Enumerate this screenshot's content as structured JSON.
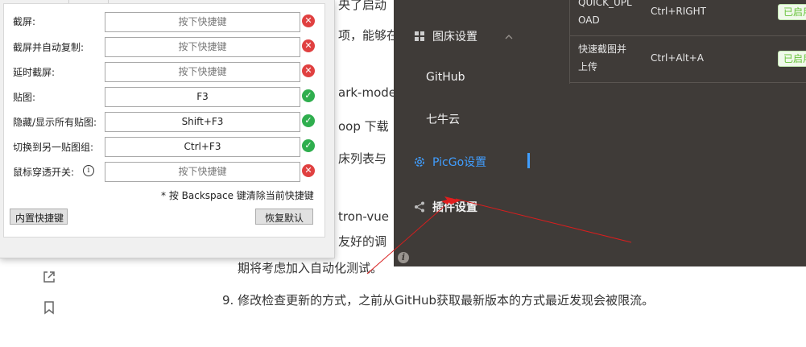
{
  "article": {
    "fragments": [
      "央了启动",
      "项，能够在",
      "ark-mode",
      "oop 下载",
      "床列表与",
      "tron-vue",
      "友好的调"
    ],
    "line_8_cont": "期将考虑加入自动化测试。",
    "line_9": "9. 修改检查更新的方式，之前从GitHub获取最新版本的方式最近发现会被限流。",
    "icons": [
      "external-link-icon",
      "bookmark-icon"
    ]
  },
  "picgo": {
    "nav": [
      {
        "label": "图床设置",
        "icon": "grid-icon"
      },
      {
        "label": "GitHub"
      },
      {
        "label": "七牛云"
      },
      {
        "label": "PicGo设置",
        "icon": "gear-icon",
        "active": true
      },
      {
        "label": "插件设置",
        "icon": "share-icon"
      }
    ],
    "table": [
      {
        "name": "QUICK_UPL OAD",
        "name_l1": "QUICK_UPL",
        "name_l2": "OAD",
        "key": "Ctrl+RIGHT",
        "status": "已启用"
      },
      {
        "name": "快速截图并上传",
        "name_l1": "快速截图并",
        "name_l2": "上传",
        "key": "Ctrl+Alt+A",
        "status": "已启用"
      }
    ],
    "accent": "#409eff"
  },
  "shortcuts": {
    "rows": [
      {
        "label": "截屏:",
        "value": "",
        "placeholder": "按下快捷键",
        "status": "error"
      },
      {
        "label": "截屏并自动复制:",
        "value": "",
        "placeholder": "按下快捷键",
        "status": "error"
      },
      {
        "label": "延时截屏:",
        "value": "",
        "placeholder": "按下快捷键",
        "status": "error"
      },
      {
        "label": "贴图:",
        "value": "F3",
        "placeholder": "按下快捷键",
        "status": "ok"
      },
      {
        "label": "隐藏/显示所有贴图:",
        "value": "Shift+F3",
        "placeholder": "按下快捷键",
        "status": "ok"
      },
      {
        "label": "切换到另一贴图组:",
        "value": "Ctrl+F3",
        "placeholder": "按下快捷键",
        "status": "ok"
      },
      {
        "label": "鼠标穿透开关:",
        "value": "",
        "placeholder": "按下快捷键",
        "status": "error"
      }
    ],
    "hint": "* 按 Backspace 键清除当前快捷键",
    "builtin_button": "内置快捷键",
    "restore_button": "恢复默认",
    "status_colors": {
      "error": "#e04040",
      "ok": "#2fae4e"
    }
  }
}
